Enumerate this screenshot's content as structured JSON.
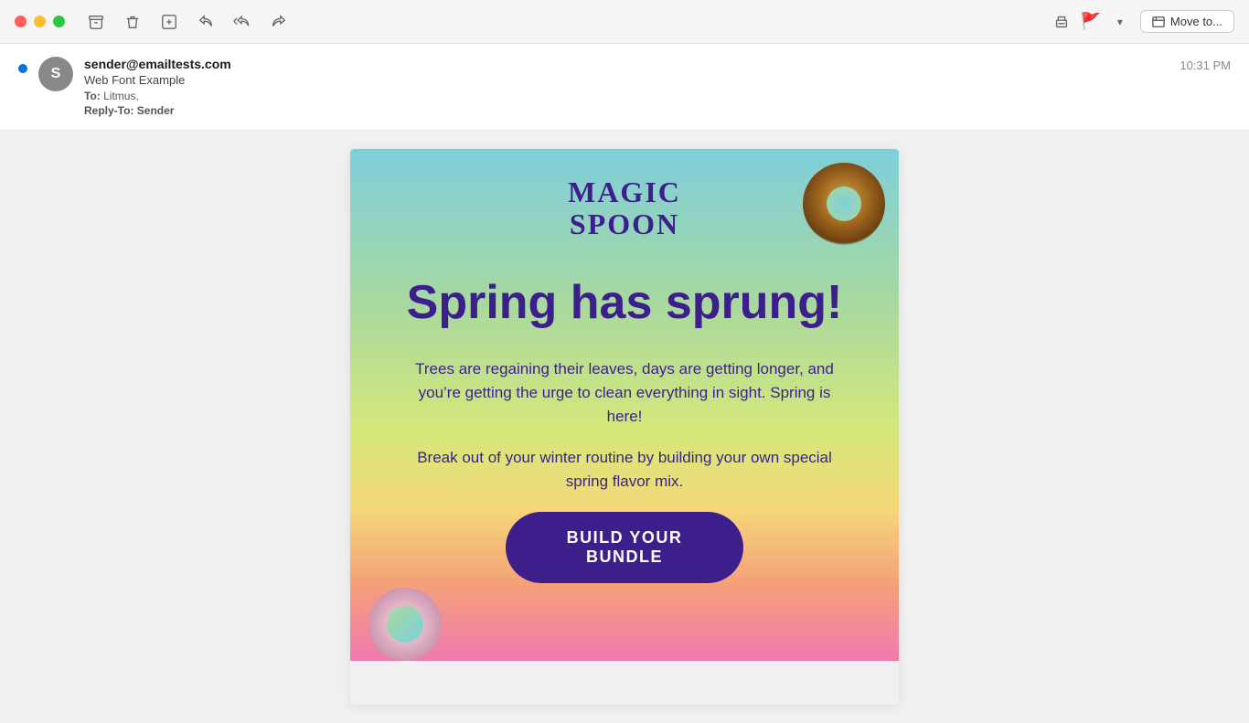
{
  "titlebar": {
    "traffic_lights": [
      "red",
      "yellow",
      "green"
    ],
    "actions": {
      "archive_label": "archive",
      "trash_label": "trash",
      "junk_label": "junk",
      "reply_label": "reply",
      "reply_all_label": "reply-all",
      "forward_label": "forward"
    },
    "right": {
      "print_label": "print",
      "flag_label": "flag",
      "move_to_label": "Move to..."
    }
  },
  "email": {
    "sender": "sender@emailtests.com",
    "subject": "Web Font Example",
    "to_label": "To:",
    "to_value": "Litmus,",
    "reply_to_label": "Reply-To:",
    "reply_to_value": "Sender",
    "timestamp": "10:31 PM",
    "avatar_letter": "S"
  },
  "email_body": {
    "logo_line1": "MAGIC",
    "logo_line2": "SPOON",
    "headline": "Spring has sprung!",
    "paragraph1": "Trees are regaining their leaves, days are getting longer, and you’re getting the urge to clean everything in sight. Spring is here!",
    "paragraph2": "Break out of your winter routine by building your own special spring flavor mix.",
    "cta_button": "BUILD YOUR BUNDLE"
  },
  "colors": {
    "unread_dot": "#0074d9",
    "logo_color": "#3d1f8c",
    "headline_color": "#3d1f8c",
    "body_text_color": "#3d1f8c",
    "cta_bg": "#3d1f8c",
    "cta_text": "#ffffff",
    "flag": "#f5a623"
  }
}
